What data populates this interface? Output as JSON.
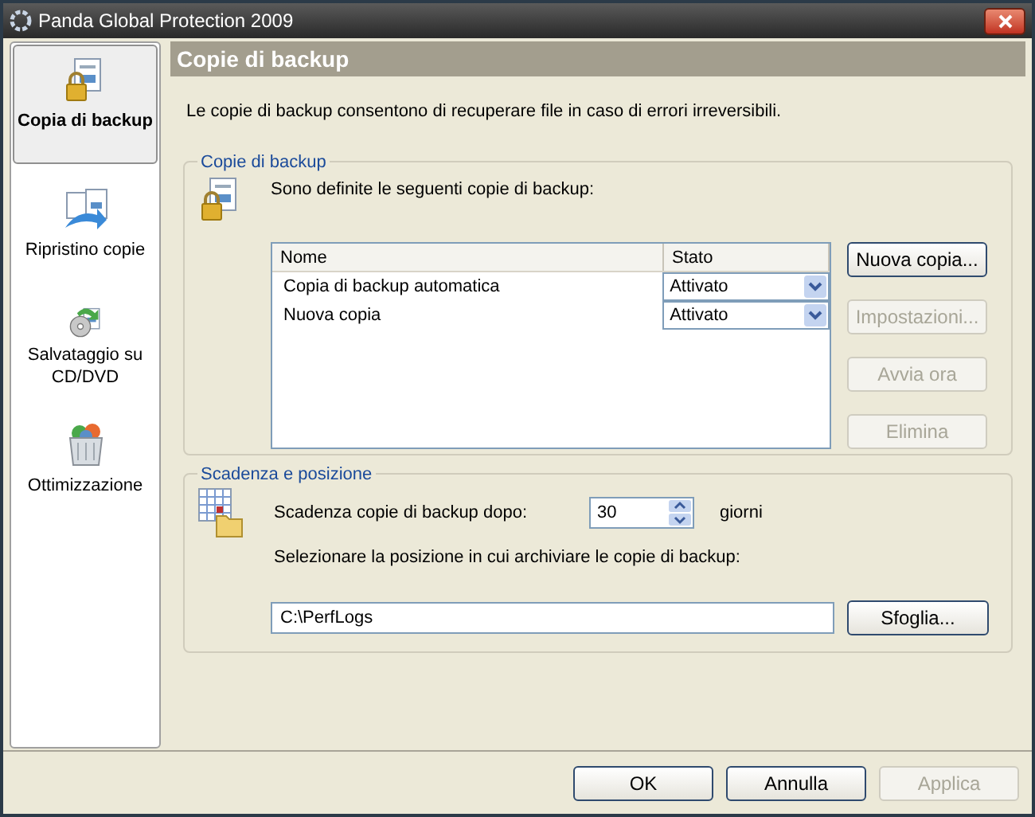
{
  "window": {
    "title": "Panda Global Protection 2009"
  },
  "sidebar": {
    "items": [
      {
        "label": "Copia di backup",
        "kind": "backup",
        "selected": true
      },
      {
        "label": "Ripristino copie",
        "kind": "restore",
        "selected": false
      },
      {
        "label": "Salvataggio su CD/DVD",
        "kind": "disc",
        "selected": false
      },
      {
        "label": "Ottimizzazione",
        "kind": "cleanup",
        "selected": false
      }
    ]
  },
  "header": "Copie di backup",
  "description": "Le copie di backup consentono di recuperare file in caso di errori irreversibili.",
  "backups_group": {
    "title": "Copie di backup",
    "intro": "Sono definite le seguenti copie di backup:",
    "table": {
      "columns": [
        "Nome",
        "Stato"
      ],
      "rows": [
        {
          "name": "Copia di backup automatica",
          "state": "Attivato"
        },
        {
          "name": "Nuova copia",
          "state": "Attivato"
        }
      ]
    },
    "buttons": [
      {
        "label": "Nuova copia...",
        "disabled": false
      },
      {
        "label": "Impostazioni...",
        "disabled": true
      },
      {
        "label": "Avvia ora",
        "disabled": true
      },
      {
        "label": "Elimina",
        "disabled": true
      }
    ]
  },
  "expiry_group": {
    "title": "Scadenza e posizione",
    "expiry_label": "Scadenza copie di backup dopo:",
    "expiry_value": "30",
    "unit": "giorni",
    "location_label": "Selezionare la posizione in cui archiviare le copie di backup:",
    "location_value": "C:\\PerfLogs",
    "browse_button": "Sfoglia..."
  },
  "footer_buttons": [
    {
      "label": "OK",
      "disabled": false
    },
    {
      "label": "Annulla",
      "disabled": false
    },
    {
      "label": "Applica",
      "disabled": true
    }
  ]
}
